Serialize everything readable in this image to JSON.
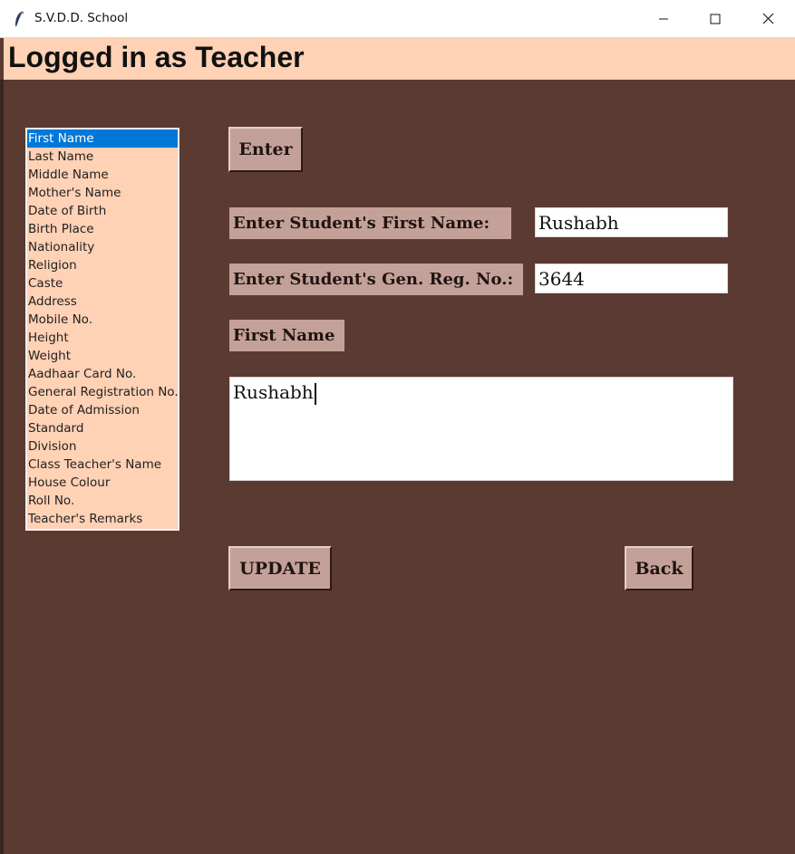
{
  "window": {
    "title": "S.V.D.D. School",
    "icons": {
      "app": "feather-icon",
      "minimize": "minimize-icon",
      "maximize": "maximize-icon",
      "close": "close-icon"
    }
  },
  "header": {
    "title": "Logged in as Teacher"
  },
  "fields_list": {
    "selected_index": 0,
    "items": [
      "First Name",
      "Last Name",
      "Middle Name",
      "Mother's Name",
      "Date of Birth",
      "Birth Place",
      "Nationality",
      "Religion",
      "Caste",
      "Address",
      "Mobile No.",
      "Height",
      "Weight",
      "Aadhaar Card No.",
      "General Registration No.",
      "Date of Admission",
      "Standard",
      "Division",
      "Class Teacher's Name",
      "House Colour",
      "Roll No.",
      "Teacher's Remarks"
    ]
  },
  "form": {
    "enter_button": "Enter",
    "first_name_label": "Enter Student's First Name:",
    "first_name_value": "Rushabh",
    "gen_reg_label": "Enter Student's Gen. Reg. No.:",
    "gen_reg_value": "3644",
    "field_label": "First Name",
    "field_value": "Rushabh",
    "update_button": "UPDATE",
    "back_button": "Back"
  },
  "colors": {
    "background": "#5b3a31",
    "header": "#ffd1b5",
    "listbox": "#ffd1b5",
    "selection": "#0078d7",
    "button": "#c4a198"
  }
}
